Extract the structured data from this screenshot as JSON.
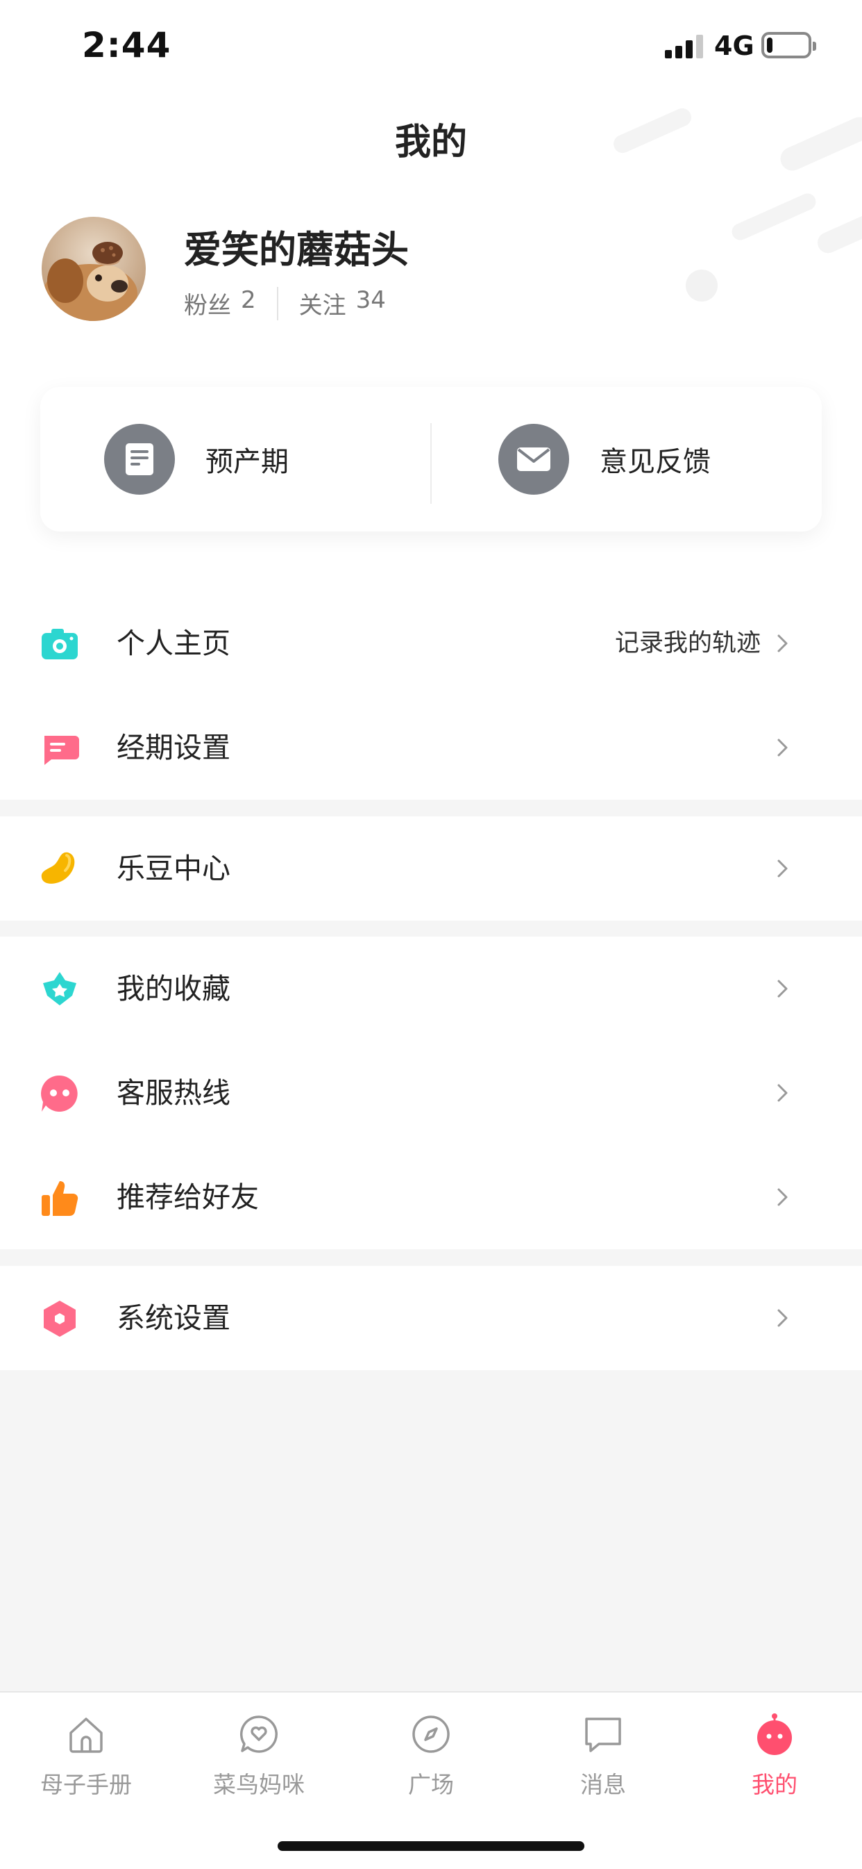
{
  "status_bar": {
    "time": "2:44",
    "network": "4G",
    "battery_level": 0.15
  },
  "header": {
    "title": "我的"
  },
  "profile": {
    "username": "爱笑的蘑菇头",
    "fans_label": "粉丝",
    "fans_count": "2",
    "following_label": "关注",
    "following_count": "34"
  },
  "quick_actions": [
    {
      "label": "预产期",
      "icon": "receipt-icon"
    },
    {
      "label": "意见反馈",
      "icon": "mail-icon"
    }
  ],
  "menu": {
    "group1": [
      {
        "label": "个人主页",
        "hint": "记录我的轨迹",
        "icon": "camera-icon",
        "color": "#2cd6d0"
      },
      {
        "label": "经期设置",
        "hint": "",
        "icon": "note-icon",
        "color": "#ff6b8a"
      }
    ],
    "group2": [
      {
        "label": "乐豆中心",
        "hint": "",
        "icon": "bean-icon",
        "color": "#f7b500"
      }
    ],
    "group3": [
      {
        "label": "我的收藏",
        "hint": "",
        "icon": "star-icon",
        "color": "#2cd6d0"
      },
      {
        "label": "客服热线",
        "hint": "",
        "icon": "chat-icon",
        "color": "#ff6b8a"
      },
      {
        "label": "推荐给好友",
        "hint": "",
        "icon": "thumbs-up-icon",
        "color": "#ff8a1a"
      }
    ],
    "group4": [
      {
        "label": "系统设置",
        "hint": "",
        "icon": "hexagon-settings-icon",
        "color": "#ff6b8a"
      }
    ]
  },
  "tabs": [
    {
      "label": "母子手册",
      "icon": "home-icon"
    },
    {
      "label": "菜鸟妈咪",
      "icon": "heart-chat-icon"
    },
    {
      "label": "广场",
      "icon": "compass-icon"
    },
    {
      "label": "消息",
      "icon": "message-icon"
    },
    {
      "label": "我的",
      "icon": "robot-icon",
      "active": true
    }
  ],
  "colors": {
    "accent": "#ff4f6f",
    "background": "#f5f5f5",
    "icon_gray": "#7b7f86"
  }
}
